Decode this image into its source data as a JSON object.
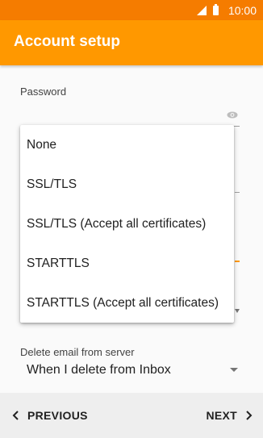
{
  "status_bar": {
    "time": "10:00",
    "icons": [
      "signal-icon",
      "battery-icon"
    ],
    "color": "#f57c00"
  },
  "app_bar": {
    "title": "Account setup",
    "color": "#ff9800"
  },
  "password": {
    "label": "Password",
    "value": "",
    "icon": "eye-icon"
  },
  "security_dropdown": {
    "options": [
      "None",
      "SSL/TLS",
      "SSL/TLS (Accept all certificates)",
      "STARTTLS",
      "STARTTLS (Accept all certificates)"
    ]
  },
  "delete_policy": {
    "label": "Delete email from server",
    "value": "When I delete from Inbox",
    "icon": "dropdown-arrow-icon"
  },
  "navigation": {
    "previous_label": "PREVIOUS",
    "next_label": "NEXT",
    "previous_icon": "chevron-left-icon",
    "next_icon": "chevron-right-icon"
  }
}
